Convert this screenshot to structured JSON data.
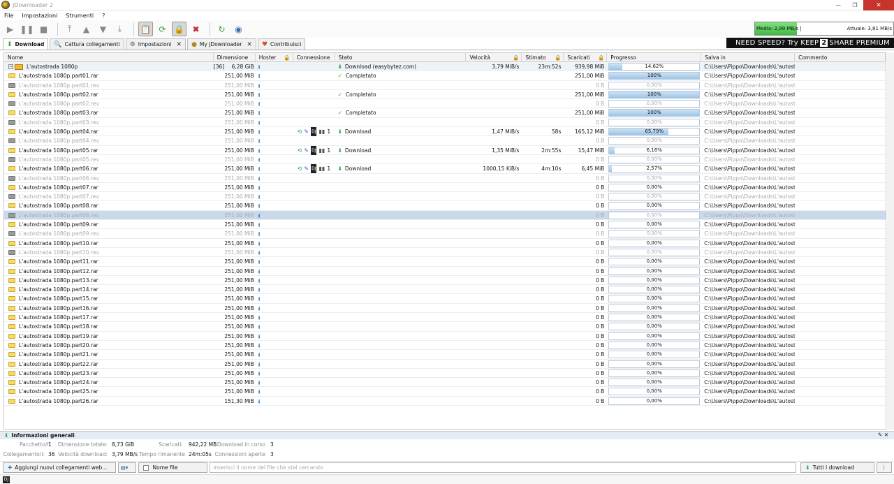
{
  "window": {
    "title": "JDownloader 2",
    "minimize": "—",
    "maximize": "❐",
    "close": "✕"
  },
  "menu": {
    "items": [
      "File",
      "Impostazioni",
      "Strumenti",
      "?"
    ]
  },
  "speed": {
    "average": "Media: 2,99 MB/s |",
    "current": "Attuale: 3,81 MB/s"
  },
  "tabs": [
    {
      "label": "Download",
      "active": true,
      "closable": false
    },
    {
      "label": "Cattura collegamenti",
      "active": false,
      "closable": false
    },
    {
      "label": "Impostazioni",
      "active": false,
      "closable": true
    },
    {
      "label": "My JDownloader",
      "active": false,
      "closable": true
    },
    {
      "label": "Contribuisci",
      "active": false,
      "closable": false
    }
  ],
  "tab_close": "✕",
  "promo": {
    "pre": "NEED SPEED? Try KEEP",
    "two": "2",
    "post": "SHARE PREMIUM"
  },
  "columns": [
    "Nome",
    "Dimensione",
    "Hoster",
    "Connessione",
    "Stato",
    "Velocità",
    "Stimato",
    "Scaricati",
    "Progresso",
    "Salva in",
    "Commento"
  ],
  "package": {
    "toggle": "−",
    "name": "L'autostrada 1080p",
    "count": "[36]",
    "size": "6,28 GiB",
    "status": "Download (easybytez.com)",
    "speed": "3,79 MiB/s",
    "eta": "23m:52s",
    "loaded": "939,98 MiB",
    "progress": 14.62,
    "progress_label": "14,62%",
    "path": "C:\\Users\\Pippo\\Downloads\\L'autost..."
  },
  "rows": [
    {
      "name": "L'autostrada 1080p.part01.rar",
      "type": "rar",
      "size": "251,00 MiB",
      "status": "Completato",
      "speed": "",
      "eta": "",
      "loaded": "251,00 MiB",
      "progress": 100,
      "label": "100%",
      "conn": false
    },
    {
      "name": "L'autostrada 1080p.part01.rev",
      "type": "rev",
      "size": "251,00 MiB",
      "status": "",
      "speed": "",
      "eta": "",
      "loaded": "0 B",
      "progress": 0,
      "label": "0,00%",
      "conn": false
    },
    {
      "name": "L'autostrada 1080p.part02.rar",
      "type": "rar",
      "size": "251,00 MiB",
      "status": "Completato",
      "speed": "",
      "eta": "",
      "loaded": "251,00 MiB",
      "progress": 100,
      "label": "100%",
      "conn": false
    },
    {
      "name": "L'autostrada 1080p.part02.rev",
      "type": "rev",
      "size": "251,00 MiB",
      "status": "",
      "speed": "",
      "eta": "",
      "loaded": "0 B",
      "progress": 0,
      "label": "0,00%",
      "conn": false
    },
    {
      "name": "L'autostrada 1080p.part03.rar",
      "type": "rar",
      "size": "251,00 MiB",
      "status": "Completato",
      "speed": "",
      "eta": "",
      "loaded": "251,00 MiB",
      "progress": 100,
      "label": "100%",
      "conn": false
    },
    {
      "name": "L'autostrada 1080p.part03.rev",
      "type": "rev",
      "size": "251,00 MiB",
      "status": "",
      "speed": "",
      "eta": "",
      "loaded": "0 B",
      "progress": 0,
      "label": "0,00%",
      "conn": false
    },
    {
      "name": "L'autostrada 1080p.part04.rar",
      "type": "rar",
      "size": "251,00 MiB",
      "status": "Download",
      "speed": "1,47 MiB/s",
      "eta": "58s",
      "loaded": "165,12 MiB",
      "progress": 65.79,
      "label": "65,79%",
      "conn": true
    },
    {
      "name": "L'autostrada 1080p.part04.rev",
      "type": "rev",
      "size": "251,00 MiB",
      "status": "",
      "speed": "",
      "eta": "",
      "loaded": "0 B",
      "progress": 0,
      "label": "0,00%",
      "conn": false
    },
    {
      "name": "L'autostrada 1080p.part05.rar",
      "type": "rar",
      "size": "251,00 MiB",
      "status": "Download",
      "speed": "1,35 MiB/s",
      "eta": "2m:55s",
      "loaded": "15,47 MiB",
      "progress": 6.16,
      "label": "6,16%",
      "conn": true
    },
    {
      "name": "L'autostrada 1080p.part05.rev",
      "type": "rev",
      "size": "251,00 MiB",
      "status": "",
      "speed": "",
      "eta": "",
      "loaded": "0 B",
      "progress": 0,
      "label": "0,00%",
      "conn": false
    },
    {
      "name": "L'autostrada 1080p.part06.rar",
      "type": "rar",
      "size": "251,00 MiB",
      "status": "Download",
      "speed": "1000,15 KiB/s",
      "eta": "4m:10s",
      "loaded": "6,45 MiB",
      "progress": 2.57,
      "label": "2,57%",
      "conn": true
    },
    {
      "name": "L'autostrada 1080p.part06.rev",
      "type": "rev",
      "size": "251,00 MiB",
      "status": "",
      "speed": "",
      "eta": "",
      "loaded": "0 B",
      "progress": 0,
      "label": "0,00%",
      "conn": false
    },
    {
      "name": "L'autostrada 1080p.part07.rar",
      "type": "rar",
      "size": "251,00 MiB",
      "status": "",
      "speed": "",
      "eta": "",
      "loaded": "0 B",
      "progress": 0,
      "label": "0,00%",
      "conn": false
    },
    {
      "name": "L'autostrada 1080p.part07.rev",
      "type": "rev",
      "size": "251,00 MiB",
      "status": "",
      "speed": "",
      "eta": "",
      "loaded": "0 B",
      "progress": 0,
      "label": "0,00%",
      "conn": false
    },
    {
      "name": "L'autostrada 1080p.part08.rar",
      "type": "rar",
      "size": "251,00 MiB",
      "status": "",
      "speed": "",
      "eta": "",
      "loaded": "0 B",
      "progress": 0,
      "label": "0,00%",
      "conn": false
    },
    {
      "name": "L'autostrada 1080p.part08.rev",
      "type": "rev",
      "size": "251,00 MiB",
      "status": "",
      "speed": "",
      "eta": "",
      "loaded": "0 B",
      "progress": 0,
      "label": "0,00%",
      "conn": false,
      "selected": true
    },
    {
      "name": "L'autostrada 1080p.part09.rar",
      "type": "rar",
      "size": "251,00 MiB",
      "status": "",
      "speed": "",
      "eta": "",
      "loaded": "0 B",
      "progress": 0,
      "label": "0,00%",
      "conn": false
    },
    {
      "name": "L'autostrada 1080p.part09.rev",
      "type": "rev",
      "size": "251,00 MiB",
      "status": "",
      "speed": "",
      "eta": "",
      "loaded": "0 B",
      "progress": 0,
      "label": "0,00%",
      "conn": false
    },
    {
      "name": "L'autostrada 1080p.part10.rar",
      "type": "rar",
      "size": "251,00 MiB",
      "status": "",
      "speed": "",
      "eta": "",
      "loaded": "0 B",
      "progress": 0,
      "label": "0,00%",
      "conn": false
    },
    {
      "name": "L'autostrada 1080p.part10.rev",
      "type": "rev",
      "size": "251,00 MiB",
      "status": "",
      "speed": "",
      "eta": "",
      "loaded": "0 B",
      "progress": 0,
      "label": "0,00%",
      "conn": false
    },
    {
      "name": "L'autostrada 1080p.part11.rar",
      "type": "rar",
      "size": "251,00 MiB",
      "status": "",
      "speed": "",
      "eta": "",
      "loaded": "0 B",
      "progress": 0,
      "label": "0,00%",
      "conn": false
    },
    {
      "name": "L'autostrada 1080p.part12.rar",
      "type": "rar",
      "size": "251,00 MiB",
      "status": "",
      "speed": "",
      "eta": "",
      "loaded": "0 B",
      "progress": 0,
      "label": "0,00%",
      "conn": false
    },
    {
      "name": "L'autostrada 1080p.part13.rar",
      "type": "rar",
      "size": "251,00 MiB",
      "status": "",
      "speed": "",
      "eta": "",
      "loaded": "0 B",
      "progress": 0,
      "label": "0,00%",
      "conn": false
    },
    {
      "name": "L'autostrada 1080p.part14.rar",
      "type": "rar",
      "size": "251,00 MiB",
      "status": "",
      "speed": "",
      "eta": "",
      "loaded": "0 B",
      "progress": 0,
      "label": "0,00%",
      "conn": false
    },
    {
      "name": "L'autostrada 1080p.part15.rar",
      "type": "rar",
      "size": "251,00 MiB",
      "status": "",
      "speed": "",
      "eta": "",
      "loaded": "0 B",
      "progress": 0,
      "label": "0,00%",
      "conn": false
    },
    {
      "name": "L'autostrada 1080p.part16.rar",
      "type": "rar",
      "size": "251,00 MiB",
      "status": "",
      "speed": "",
      "eta": "",
      "loaded": "0 B",
      "progress": 0,
      "label": "0,00%",
      "conn": false
    },
    {
      "name": "L'autostrada 1080p.part17.rar",
      "type": "rar",
      "size": "251,00 MiB",
      "status": "",
      "speed": "",
      "eta": "",
      "loaded": "0 B",
      "progress": 0,
      "label": "0,00%",
      "conn": false
    },
    {
      "name": "L'autostrada 1080p.part18.rar",
      "type": "rar",
      "size": "251,00 MiB",
      "status": "",
      "speed": "",
      "eta": "",
      "loaded": "0 B",
      "progress": 0,
      "label": "0,00%",
      "conn": false
    },
    {
      "name": "L'autostrada 1080p.part19.rar",
      "type": "rar",
      "size": "251,00 MiB",
      "status": "",
      "speed": "",
      "eta": "",
      "loaded": "0 B",
      "progress": 0,
      "label": "0,00%",
      "conn": false
    },
    {
      "name": "L'autostrada 1080p.part20.rar",
      "type": "rar",
      "size": "251,00 MiB",
      "status": "",
      "speed": "",
      "eta": "",
      "loaded": "0 B",
      "progress": 0,
      "label": "0,00%",
      "conn": false
    },
    {
      "name": "L'autostrada 1080p.part21.rar",
      "type": "rar",
      "size": "251,00 MiB",
      "status": "",
      "speed": "",
      "eta": "",
      "loaded": "0 B",
      "progress": 0,
      "label": "0,00%",
      "conn": false
    },
    {
      "name": "L'autostrada 1080p.part22.rar",
      "type": "rar",
      "size": "251,00 MiB",
      "status": "",
      "speed": "",
      "eta": "",
      "loaded": "0 B",
      "progress": 0,
      "label": "0,00%",
      "conn": false
    },
    {
      "name": "L'autostrada 1080p.part23.rar",
      "type": "rar",
      "size": "251,00 MiB",
      "status": "",
      "speed": "",
      "eta": "",
      "loaded": "0 B",
      "progress": 0,
      "label": "0,00%",
      "conn": false
    },
    {
      "name": "L'autostrada 1080p.part24.rar",
      "type": "rar",
      "size": "251,00 MiB",
      "status": "",
      "speed": "",
      "eta": "",
      "loaded": "0 B",
      "progress": 0,
      "label": "0,00%",
      "conn": false
    },
    {
      "name": "L'autostrada 1080p.part25.rar",
      "type": "rar",
      "size": "251,00 MiB",
      "status": "",
      "speed": "",
      "eta": "",
      "loaded": "0 B",
      "progress": 0,
      "label": "0,00%",
      "conn": false
    },
    {
      "name": "L'autostrada 1080p.part26.rar",
      "type": "rar",
      "size": "151,30 MiB",
      "status": "",
      "speed": "",
      "eta": "",
      "loaded": "0 B",
      "progress": 0,
      "label": "0,00%",
      "conn": false
    }
  ],
  "row_path": "C:\\Users\\Pippo\\Downloads\\L'autost...",
  "conn_count": "1",
  "info": {
    "title": "Informazioni generali",
    "tools": "✎ ✕",
    "labels": {
      "pacchetti": "Pacchetto/i:",
      "collegamenti": "Collegamento/i:",
      "dim_totale": "Dimensione totale:",
      "vel": "Velocità download:",
      "scaricati": "Scaricati:",
      "tempo": "Tempo rimanente",
      "in_corso": "Download in corso",
      "conn_aperte": "Connessioni aperte"
    },
    "values": {
      "pacchetti": "1",
      "collegamenti": "36",
      "dim_totale": "8,73 GiB",
      "vel": "3,79 MB/s",
      "scaricati": "942,22 MB",
      "tempo": "24m:05s",
      "in_corso": "3",
      "conn_aperte": "3"
    }
  },
  "bottom": {
    "add_links": "Aggiungi nuovi collegamenti web...",
    "filter_label": "Nome file",
    "search_placeholder": "Inserisci il nome del file che stai cercando",
    "all_downloads": "Tutti i download"
  },
  "status_icon": "DJ"
}
